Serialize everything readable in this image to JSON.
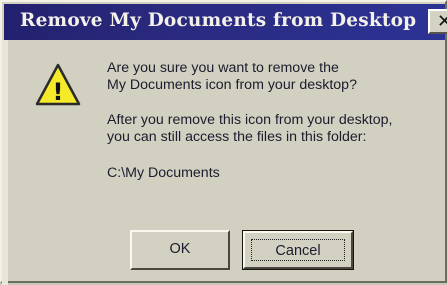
{
  "window": {
    "title": "Remove My Documents from Desktop",
    "close_glyph": "✕"
  },
  "icon": {
    "name": "warning-icon",
    "glyph": "!",
    "fill": "#f5ea2a",
    "stroke": "#2a2a2a"
  },
  "message": {
    "question_line1": "Are you sure you want to remove the",
    "question_line2": "My Documents icon from your desktop?",
    "info_line1": "After you remove this icon from your desktop,",
    "info_line2": "you can still access the files in this folder:",
    "path": "C:\\My Documents"
  },
  "buttons": {
    "ok_label": "OK",
    "cancel_label": "Cancel"
  },
  "colors": {
    "titlebar": "#23216e",
    "title_text": "#f4f1ea",
    "dialog_face": "#d2d0c0"
  }
}
